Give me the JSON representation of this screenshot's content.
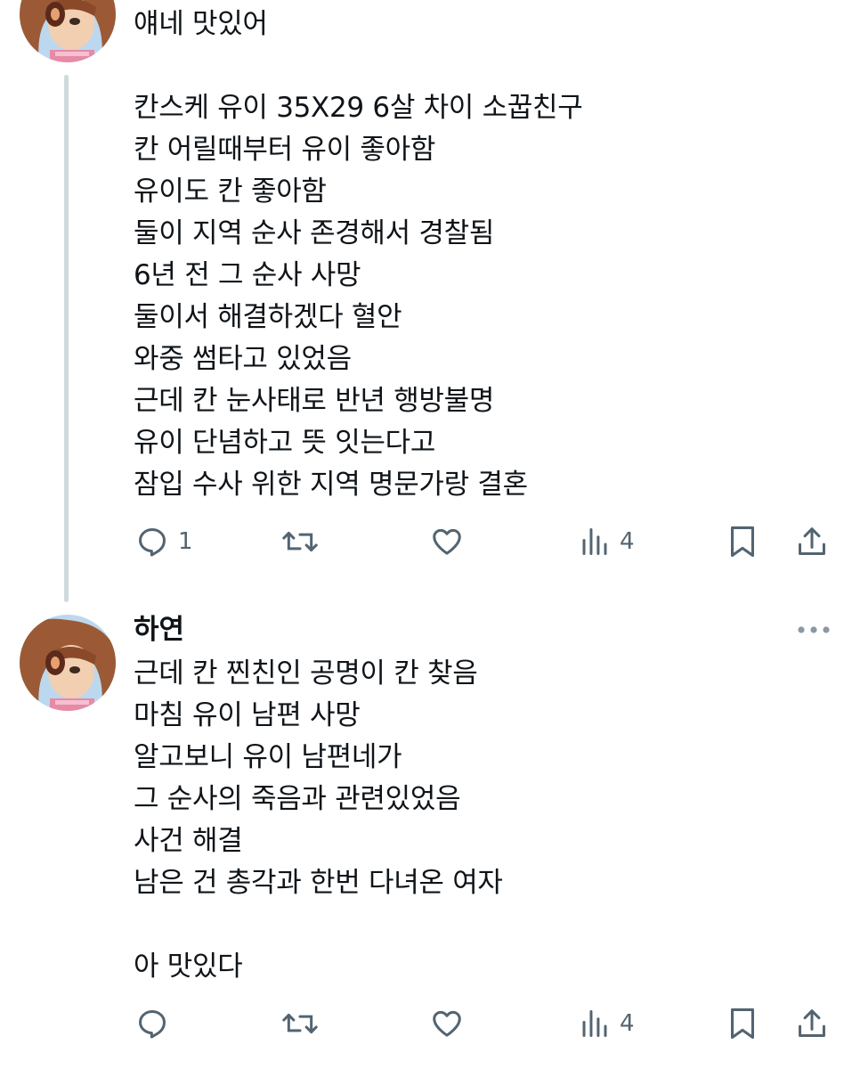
{
  "tweet1": {
    "text": "얘네 맛있어\n\n칸스케 유이 35X29 6살 차이 소꿉친구\n칸 어릴때부터 유이 좋아함\n유이도 칸 좋아함\n둘이 지역 순사 존경해서 경찰됨\n6년 전 그 순사 사망\n둘이서 해결하겠다 혈안\n와중 썸타고 있었음\n근데 칸 눈사태로 반년 행방불명\n유이 단념하고 뜻 잇는다고\n잠입 수사 위한 지역 명문가랑 결혼",
    "actions": {
      "reply_count": "1",
      "views_count": "4"
    }
  },
  "tweet2": {
    "author": "하연",
    "text": "근데 칸 찐친인 공명이 칸 찾음\n마침 유이 남편 사망\n알고보니 유이 남편네가\n그 순사의 죽음과 관련있었음\n사건 해결\n남은 건 총각과 한번 다녀온 여자\n\n아 맛있다",
    "actions": {
      "reply_count": "",
      "views_count": "4"
    }
  },
  "icons": [
    "reply-icon",
    "retweet-icon",
    "like-icon",
    "views-icon",
    "bookmark-icon",
    "share-icon",
    "more-icon"
  ],
  "colors": {
    "icon": "#536471",
    "text": "#0f1419",
    "thread_line": "#cfd9de"
  }
}
